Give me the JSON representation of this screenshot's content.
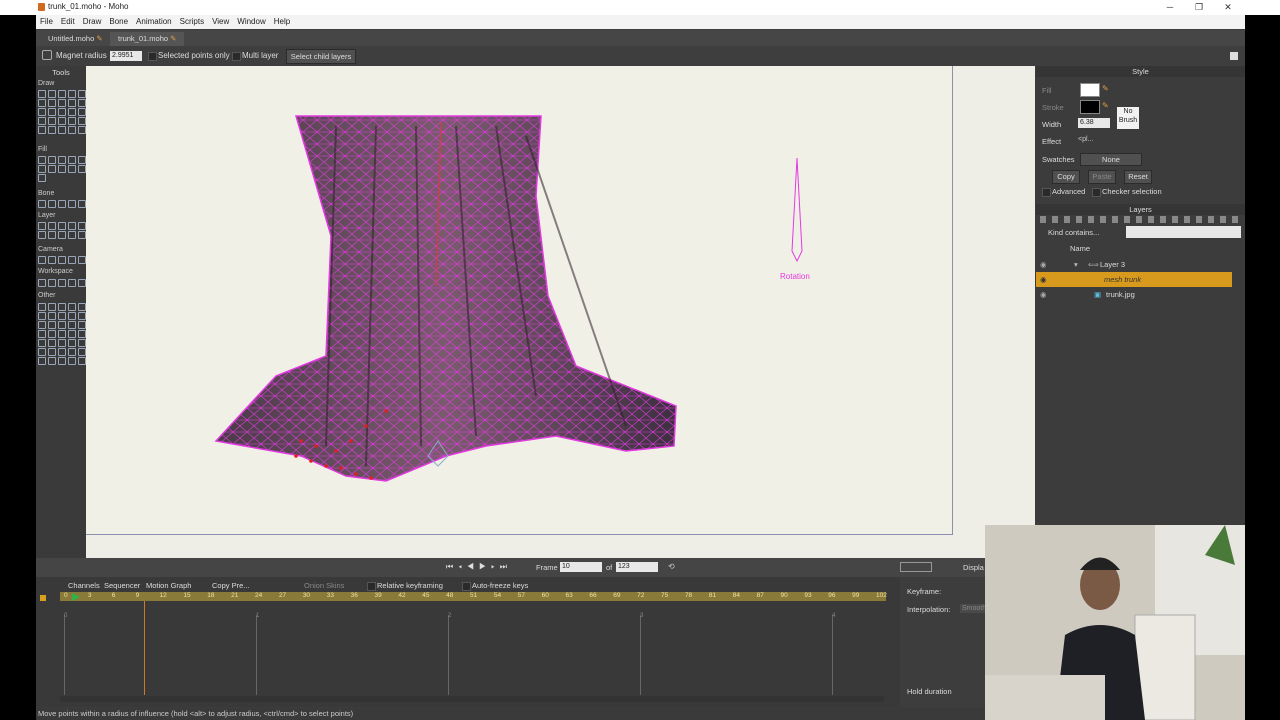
{
  "window": {
    "title": "trunk_01.moho - Moho",
    "min": "─",
    "max": "❐",
    "close": "✕"
  },
  "menu": [
    "File",
    "Edit",
    "Draw",
    "Bone",
    "Animation",
    "Scripts",
    "View",
    "Window",
    "Help"
  ],
  "doc_tabs": [
    {
      "label": "Untitled.moho"
    },
    {
      "label": "trunk_01.moho"
    }
  ],
  "options": {
    "magnet_label": "Magnet radius",
    "magnet_value": "2.9951",
    "selected_points": "Selected points only",
    "multi_layer": "Multi layer",
    "select_child": "Select child layers"
  },
  "tools": {
    "title": "Tools",
    "sections": [
      "Draw",
      "Fill",
      "Bone",
      "Layer",
      "Camera",
      "Workspace",
      "Other"
    ]
  },
  "canvas": {
    "rotation_label": "Rotation"
  },
  "playback": {
    "frame_label": "Frame",
    "frame_value": "10",
    "of_label": "of",
    "total_value": "123",
    "display_label": "Displa"
  },
  "timeline": {
    "tabs": [
      "Channels",
      "Sequencer",
      "Motion Graph"
    ],
    "copy_label": "Copy Pre...",
    "onion_label": "Onion Skins",
    "relative_label": "Relative keyframing",
    "autofreeze_label": "Auto-freeze keys",
    "ruler": [
      "0",
      "3",
      "6",
      "9",
      "12",
      "15",
      "18",
      "21",
      "24",
      "27",
      "30",
      "33",
      "36",
      "39",
      "42",
      "45",
      "48",
      "51",
      "54",
      "57",
      "60",
      "63",
      "66",
      "69",
      "72",
      "75",
      "78",
      "81",
      "84",
      "87",
      "90",
      "93",
      "96",
      "99",
      "102"
    ],
    "markers": [
      "0",
      "1",
      "2",
      "3",
      "4"
    ]
  },
  "keyframe_panel": {
    "keyframe_label": "Keyframe:",
    "interp_label": "Interpolation:",
    "interp_value": "Smooth",
    "hold_label": "Hold duration"
  },
  "style_panel": {
    "title": "Style",
    "fill_label": "Fill",
    "stroke_label": "Stroke",
    "no_brush": "No Brush",
    "width_label": "Width",
    "width_value": "6.38",
    "effect_label": "Effect",
    "effect_value": "<pl...",
    "swatches_label": "Swatches",
    "swatches_value": "None",
    "copy": "Copy",
    "paste": "Paste",
    "reset": "Reset",
    "advanced": "Advanced",
    "checker": "Checker selection"
  },
  "layers_panel": {
    "title": "Layers",
    "filter_label": "Kind contains...",
    "name_header": "Name",
    "rows": [
      {
        "label": "Layer 3"
      },
      {
        "label": "mesh trunk"
      },
      {
        "label": "trunk.jpg"
      }
    ]
  },
  "status": "Move points within a radius of influence (hold <alt> to adjust radius, <ctrl/cmd> to select points)",
  "colors": {
    "accent": "#d89a1c",
    "mesh": "#e23ae0",
    "bark": "#6b4c5e"
  }
}
